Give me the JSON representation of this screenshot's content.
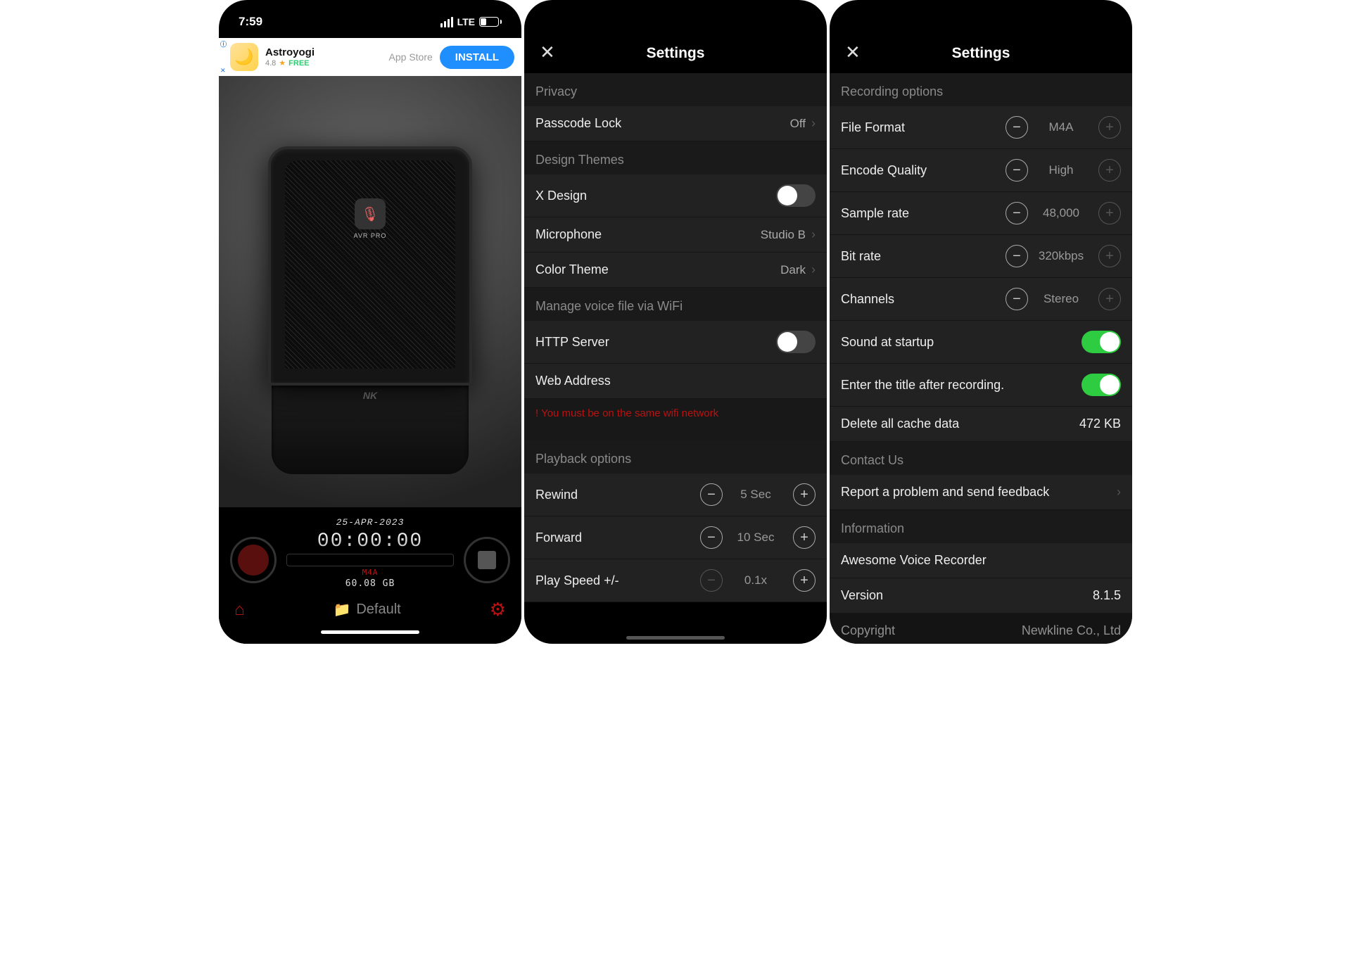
{
  "screen1": {
    "status": {
      "time": "7:59",
      "net": "LTE",
      "battery_pct": "31"
    },
    "ad": {
      "title": "Astroyogi",
      "rating": "4.8",
      "free": "FREE",
      "store": "App Store",
      "cta": "INSTALL"
    },
    "mic": {
      "label": "AVR PRO",
      "brand": "NK"
    },
    "rec": {
      "date": "25-APR-2023",
      "time": "00:00:00",
      "format": "M4A",
      "storage": "60.08 GB",
      "folder": "Default"
    }
  },
  "screen2": {
    "title": "Settings",
    "sections": {
      "privacy": {
        "header": "Privacy",
        "passcode_label": "Passcode Lock",
        "passcode_val": "Off"
      },
      "design": {
        "header": "Design Themes",
        "xdesign_label": "X Design",
        "microphone_label": "Microphone",
        "microphone_val": "Studio B",
        "color_label": "Color Theme",
        "color_val": "Dark"
      },
      "wifi": {
        "header": "Manage voice file via WiFi",
        "http_label": "HTTP Server",
        "web_label": "Web Address",
        "warning": "! You must be on the same wifi network"
      },
      "playback": {
        "header": "Playback options",
        "rewind_label": "Rewind",
        "rewind_val": "5 Sec",
        "forward_label": "Forward",
        "forward_val": "10 Sec",
        "speed_label": "Play Speed +/-",
        "speed_val": "0.1x"
      }
    }
  },
  "screen3": {
    "title": "Settings",
    "recopt": {
      "header": "Recording options",
      "format_label": "File Format",
      "format_val": "M4A",
      "quality_label": "Encode Quality",
      "quality_val": "High",
      "sample_label": "Sample rate",
      "sample_val": "48,000",
      "bitrate_label": "Bit rate",
      "bitrate_val": "320kbps",
      "channels_label": "Channels",
      "channels_val": "Stereo",
      "startup_label": "Sound at startup",
      "title_after_label": "Enter the title after recording.",
      "cache_label": "Delete all cache data",
      "cache_val": "472 KB"
    },
    "contact": {
      "header": "Contact Us",
      "report_label": "Report a problem and send feedback"
    },
    "info": {
      "header": "Information",
      "app_label": "Awesome Voice Recorder",
      "version_label": "Version",
      "version_val": "8.1.5",
      "copyright_label": "Copyright",
      "copyright_val": "Newkline Co., Ltd"
    }
  }
}
